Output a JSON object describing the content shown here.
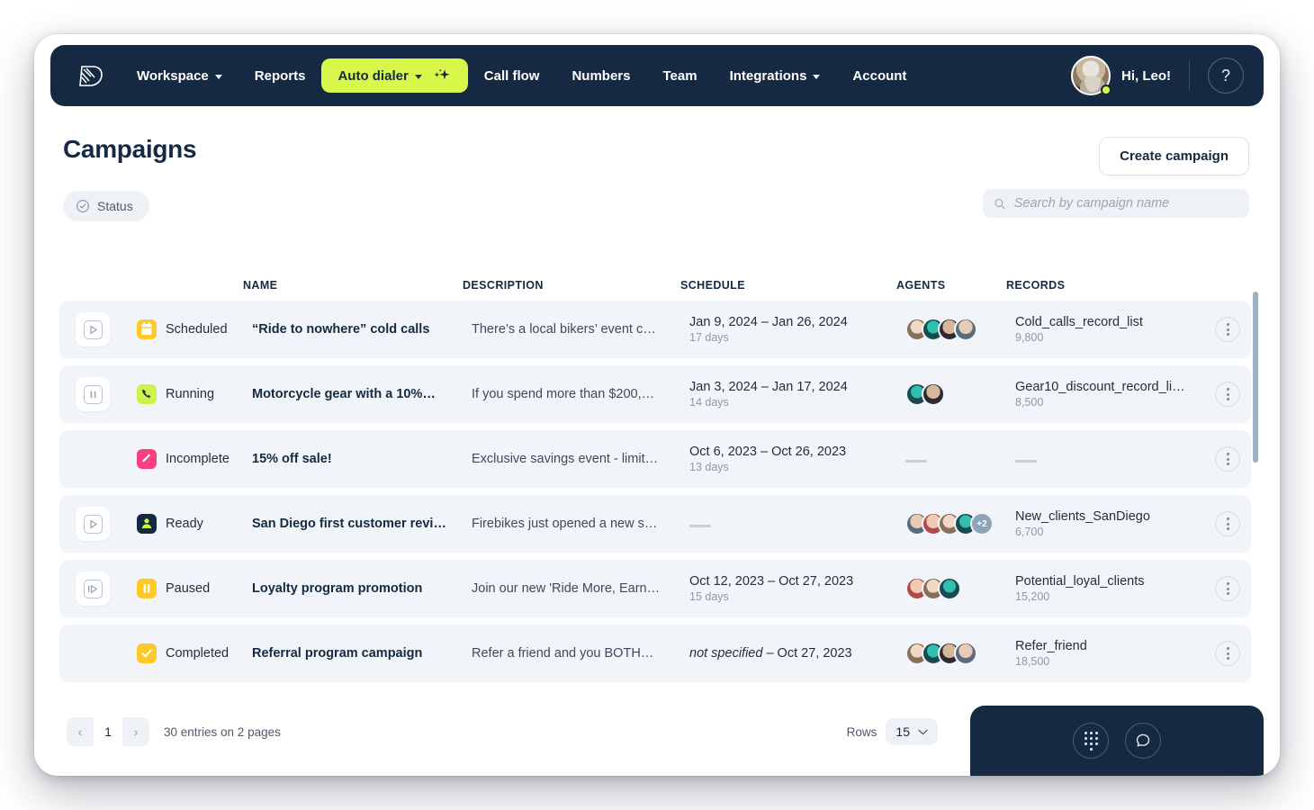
{
  "nav": {
    "logo_icon": "brand-logo-icon",
    "items": [
      {
        "label": "Workspace",
        "caret": true,
        "active": false
      },
      {
        "label": "Reports",
        "caret": false,
        "active": false
      },
      {
        "label": "Auto dialer",
        "caret": true,
        "active": true,
        "sparkle": true
      },
      {
        "label": "Call flow",
        "caret": false,
        "active": false
      },
      {
        "label": "Numbers",
        "caret": false,
        "active": false
      },
      {
        "label": "Team",
        "caret": false,
        "active": false
      },
      {
        "label": "Integrations",
        "caret": true,
        "active": false
      },
      {
        "label": "Account",
        "caret": false,
        "active": false
      }
    ],
    "greeting": "Hi, Leo!",
    "help_label": "?",
    "accent": "#d7f84b",
    "bar_color": "#152a42"
  },
  "header": {
    "title": "Campaigns",
    "create_label": "Create campaign",
    "status_filter_label": "Status",
    "search_placeholder": "Search by campaign name",
    "search_value": ""
  },
  "table": {
    "columns": [
      "NAME",
      "DESCRIPTION",
      "SCHEDULE",
      "AGENTS",
      "RECORDS"
    ],
    "rows": [
      {
        "action": "play",
        "status": "Scheduled",
        "status_color": "#ffc928",
        "status_icon": "calendar-icon",
        "name": "“Ride to nowhere” cold calls",
        "description": "There’s a local bikers’ event c…",
        "schedule": "Jan 9, 2024 – Jan 26, 2024",
        "schedule_italic_prefix": "",
        "duration": "17 days",
        "agents": 4,
        "agents_extra": "",
        "record_name": "Cold_calls_record_list",
        "record_count": "9,800"
      },
      {
        "action": "pause",
        "status": "Running",
        "status_color": "#cdf24a",
        "status_icon": "phone-icon",
        "name": "Motorcycle gear with a 10%…",
        "description": "If you spend more than $200,…",
        "schedule": "Jan 3, 2024 – Jan 17, 2024",
        "schedule_italic_prefix": "",
        "duration": "14 days",
        "agents": 2,
        "agents_extra": "",
        "record_name": "Gear10_discount_record_li…",
        "record_count": "8,500"
      },
      {
        "action": "none",
        "status": "Incomplete",
        "status_color": "#fb3f7e",
        "status_icon": "pencil-icon",
        "name": "15% off sale!",
        "description": "Exclusive savings event - limit…",
        "schedule": "Oct 6, 2023 – Oct 26, 2023",
        "schedule_italic_prefix": "",
        "duration": "13 days",
        "agents": 0,
        "agents_extra": "",
        "record_name": "",
        "record_count": ""
      },
      {
        "action": "play-dark",
        "status": "Ready",
        "status_color": "#152a42",
        "status_icon": "user-check-icon",
        "name": "San Diego first customer revi…",
        "description": "Firebikes just opened a new s…",
        "schedule": "",
        "schedule_italic_prefix": "",
        "duration": "",
        "agents": 4,
        "agents_extra": "+2",
        "record_name": "New_clients_SanDiego",
        "record_count": "6,700"
      },
      {
        "action": "resume",
        "status": "Paused",
        "status_color": "#ffc928",
        "status_icon": "pause-icon",
        "name": "Loyalty program promotion",
        "description": "Join our new 'Ride More, Earn…",
        "schedule": "Oct 12, 2023 – Oct 27, 2023",
        "schedule_italic_prefix": "",
        "duration": "15 days",
        "agents": 3,
        "agents_extra": "",
        "record_name": "Potential_loyal_clients",
        "record_count": "15,200"
      },
      {
        "action": "none",
        "status": "Completed",
        "status_color": "#ffc928",
        "status_icon": "check-icon",
        "name": "Referral program campaign",
        "description": "Refer a friend and you BOTH…",
        "schedule": " – Oct 27, 2023",
        "schedule_italic_prefix": "not specified",
        "duration": "",
        "agents": 4,
        "agents_extra": "",
        "record_name": "Refer_friend",
        "record_count": "18,500"
      }
    ]
  },
  "footer": {
    "prev_label": "‹",
    "page_number": "1",
    "next_label": "›",
    "entries_text": "30 entries on 2 pages",
    "rows_label": "Rows",
    "rows_value": "15"
  },
  "widget": {
    "dialpad_icon": "dialpad-icon",
    "chat_icon": "chat-bubble-icon"
  }
}
